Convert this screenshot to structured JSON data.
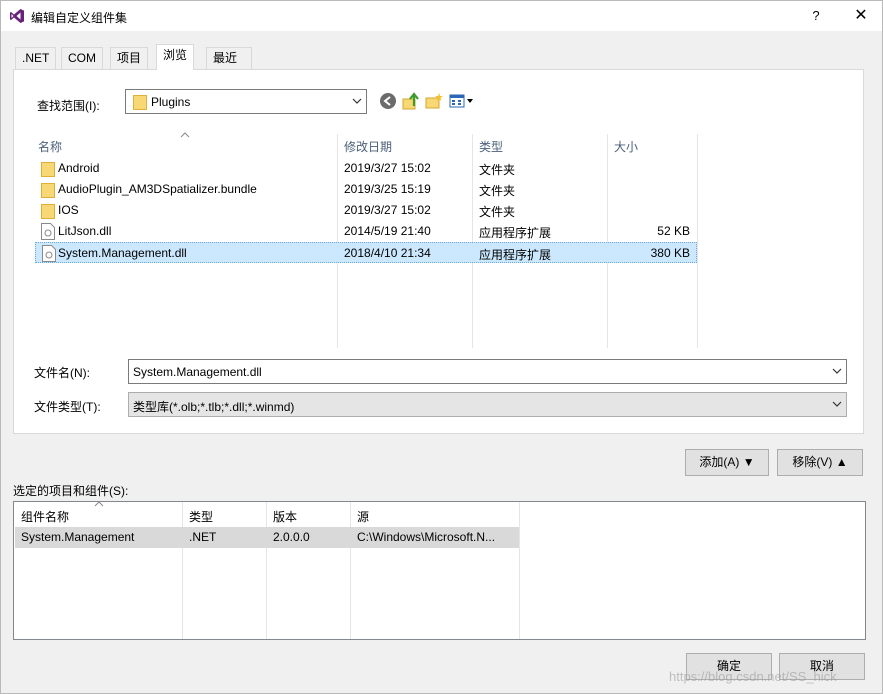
{
  "window": {
    "title": "编辑自定义组件集",
    "help": "?",
    "close": "✕"
  },
  "tabs": [
    {
      "label": ".NET"
    },
    {
      "label": "COM"
    },
    {
      "label": "项目"
    },
    {
      "label": "浏览"
    },
    {
      "label": "最近"
    }
  ],
  "lookin": {
    "label": "查找范围(I):",
    "value": "Plugins"
  },
  "toolbar": {
    "back": "back-icon",
    "up": "up-folder-icon",
    "new_folder": "new-folder-icon",
    "view": "view-menu-icon"
  },
  "file_list": {
    "columns": [
      "名称",
      "修改日期",
      "类型",
      "大小"
    ],
    "rows": [
      {
        "name": "Android",
        "date": "2019/3/27 15:02",
        "type": "文件夹",
        "size": "",
        "icon": "folder-icon"
      },
      {
        "name": "AudioPlugin_AM3DSpatializer.bundle",
        "date": "2019/3/25 15:19",
        "type": "文件夹",
        "size": "",
        "icon": "folder-icon"
      },
      {
        "name": "IOS",
        "date": "2019/3/27 15:02",
        "type": "文件夹",
        "size": "",
        "icon": "folder-icon"
      },
      {
        "name": "LitJson.dll",
        "date": "2014/5/19 21:40",
        "type": "应用程序扩展",
        "size": "52 KB",
        "icon": "dll-file-icon"
      },
      {
        "name": "System.Management.dll",
        "date": "2018/4/10 21:34",
        "type": "应用程序扩展",
        "size": "380 KB",
        "icon": "dll-file-icon"
      }
    ]
  },
  "filename": {
    "label": "文件名(N):",
    "value": "System.Management.dll"
  },
  "filetype": {
    "label": "文件类型(T):",
    "value": "类型库(*.olb;*.tlb;*.dll;*.winmd)"
  },
  "buttons": {
    "add": "添加(A) ▼",
    "remove": "移除(V) ▲",
    "ok": "确定",
    "cancel": "取消"
  },
  "selected": {
    "label": "选定的项目和组件(S):",
    "columns": [
      "组件名称",
      "类型",
      "版本",
      "源"
    ],
    "row": {
      "name": "System.Management",
      "type": ".NET",
      "version": "2.0.0.0",
      "source": "C:\\Windows\\Microsoft.N..."
    }
  },
  "watermark": "https://blog.csdn.net/SS_hick",
  "colors": {
    "accent": "#cce8ff",
    "folder": "#f8d775",
    "header_text": "#4c607a"
  }
}
